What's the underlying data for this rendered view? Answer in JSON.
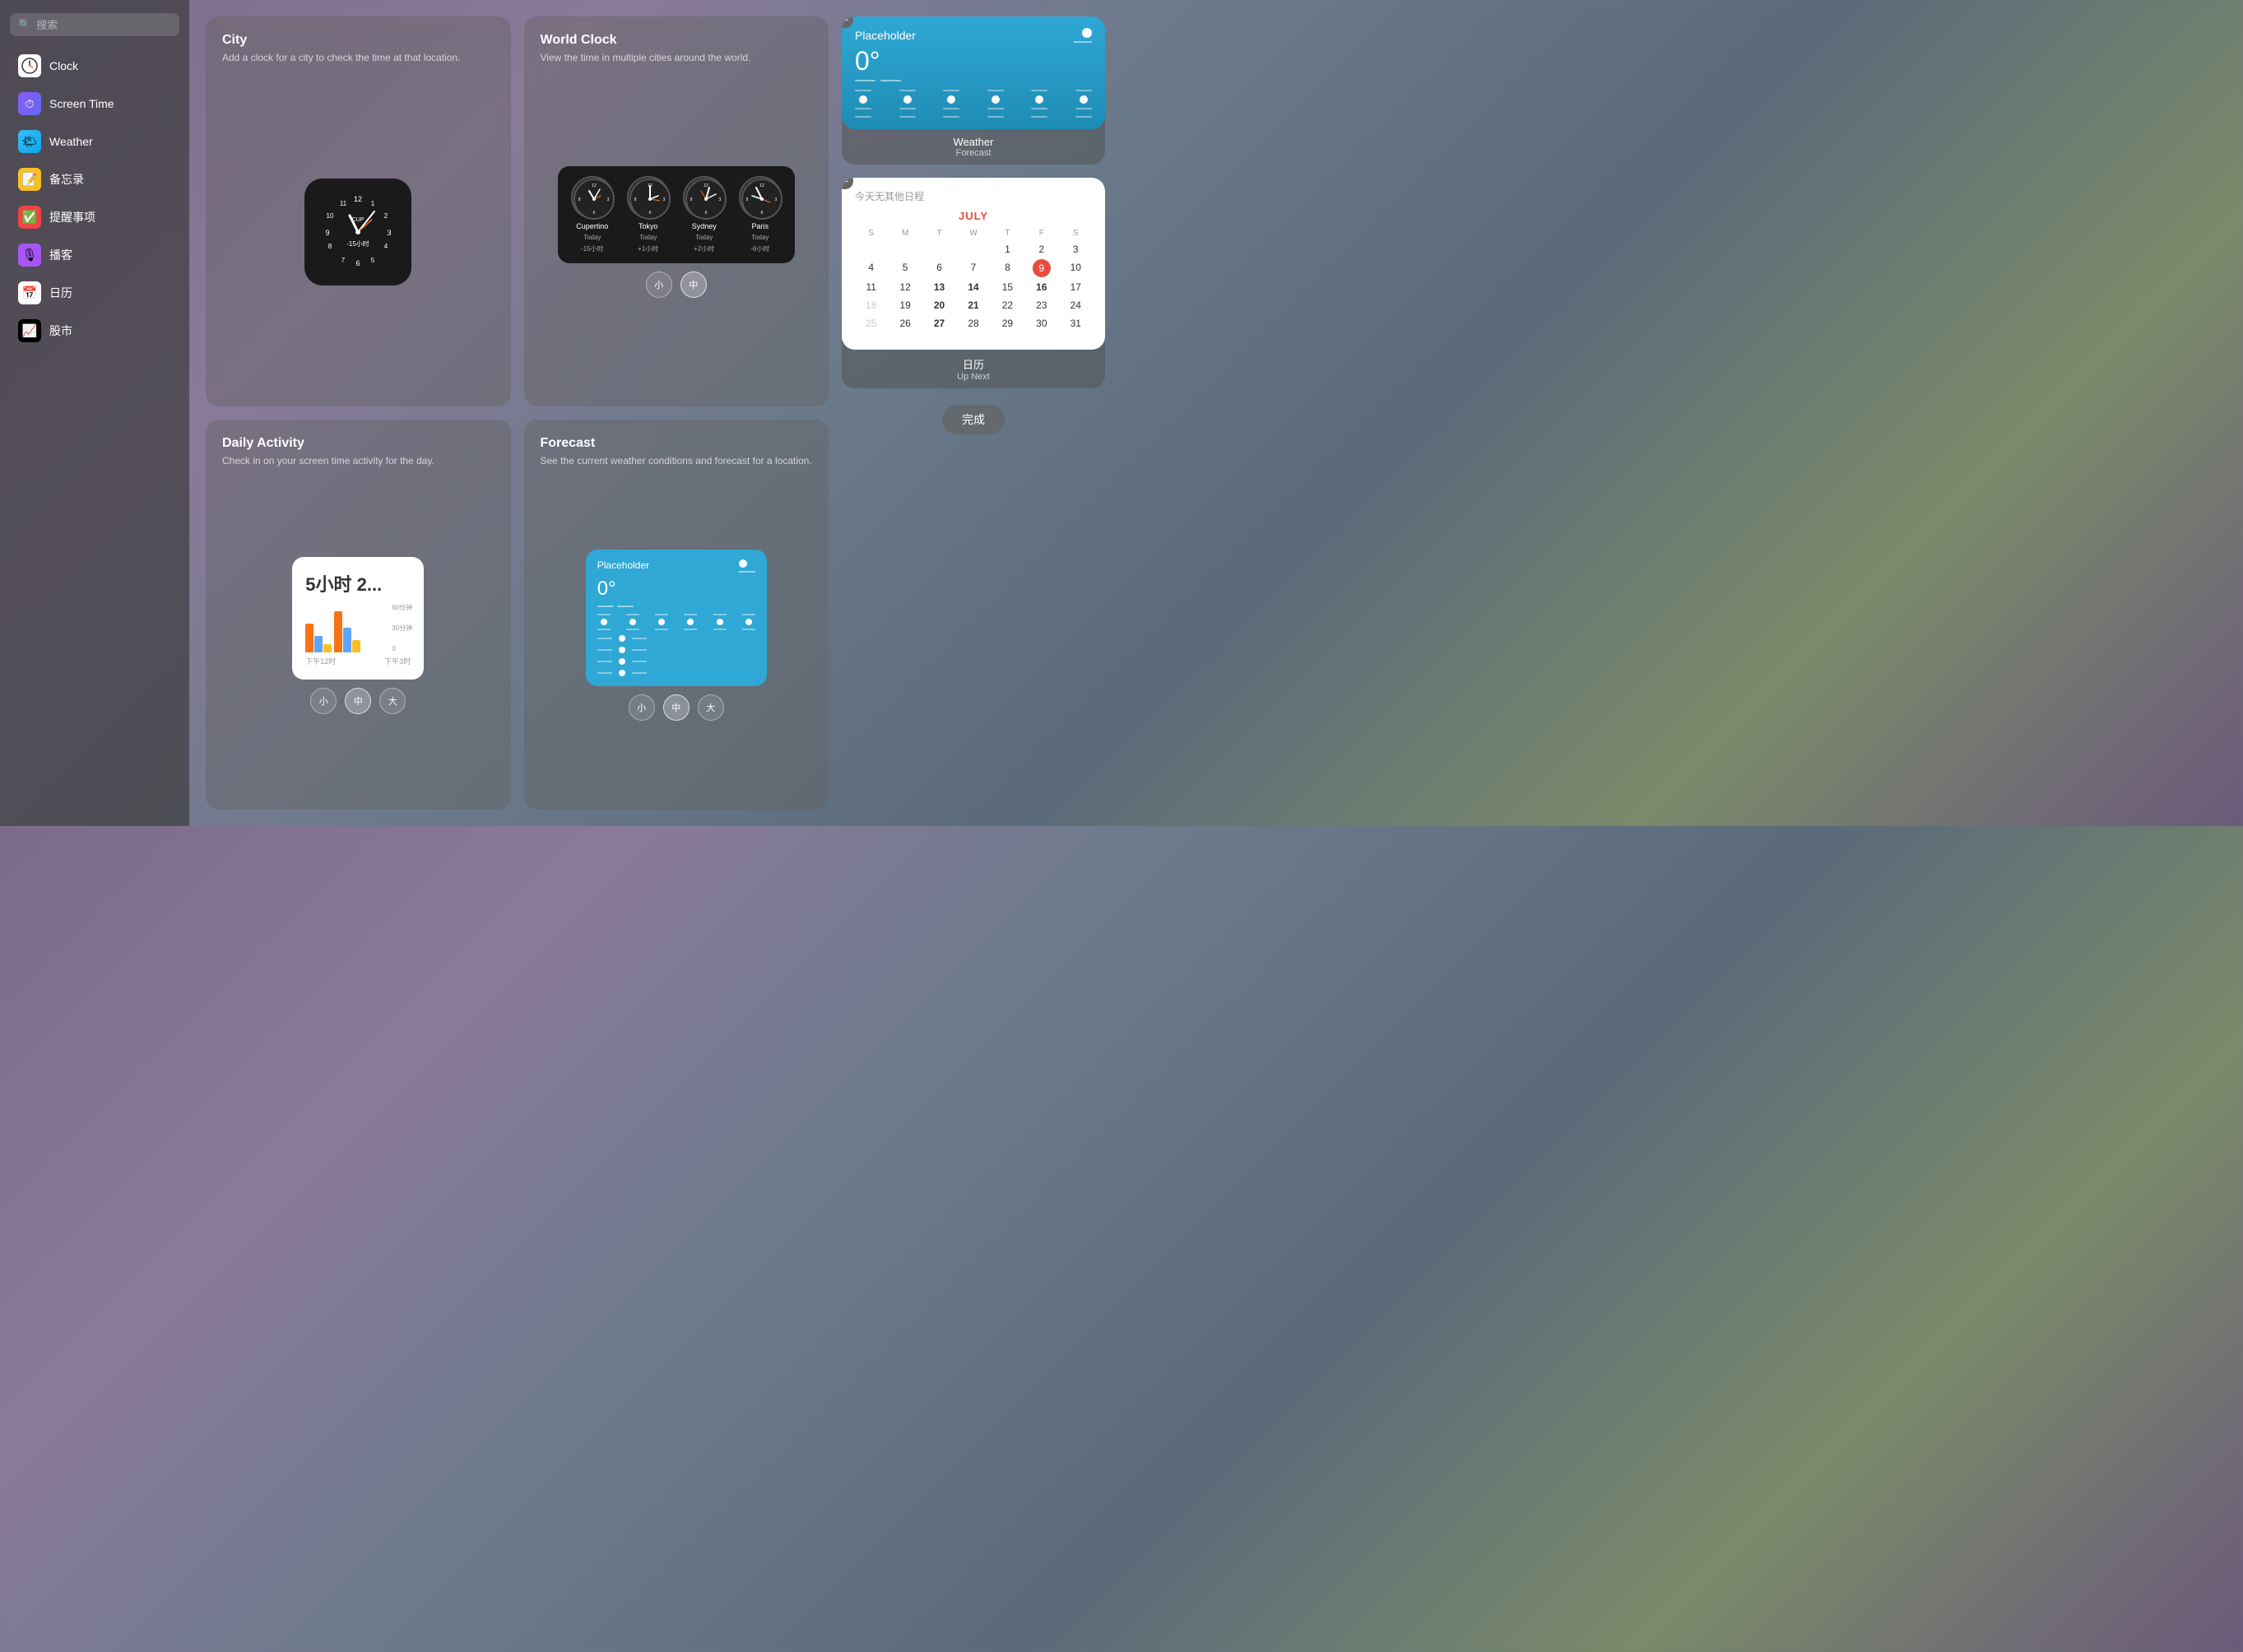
{
  "sidebar": {
    "search_placeholder": "搜索",
    "items": [
      {
        "id": "clock",
        "label": "Clock",
        "icon": "🕐",
        "icon_type": "clock"
      },
      {
        "id": "screentime",
        "label": "Screen Time",
        "icon": "⏱",
        "icon_type": "screentime"
      },
      {
        "id": "weather",
        "label": "Weather",
        "icon": "🌤",
        "icon_type": "weather"
      },
      {
        "id": "notes",
        "label": "备忘录",
        "icon": "📝",
        "icon_type": "notes"
      },
      {
        "id": "reminders",
        "label": "提醒事项",
        "icon": "✅",
        "icon_type": "reminders"
      },
      {
        "id": "podcasts",
        "label": "播客",
        "icon": "🎙",
        "icon_type": "podcasts"
      },
      {
        "id": "calendar",
        "label": "日历",
        "icon": "📅",
        "icon_type": "calendar"
      },
      {
        "id": "stocks",
        "label": "股市",
        "icon": "📈",
        "icon_type": "stocks"
      }
    ]
  },
  "panels": {
    "city": {
      "title": "City",
      "description": "Add a clock for a city to check the time at that location."
    },
    "world_clock": {
      "title": "World Clock",
      "description": "View the time in multiple cities around the world.",
      "cities": [
        {
          "name": "Cupertino",
          "day": "Today",
          "offset": "-15小时"
        },
        {
          "name": "Tokyo",
          "day": "Today",
          "offset": "+1小时"
        },
        {
          "name": "Sydney",
          "day": "Today",
          "offset": "+2小时"
        },
        {
          "name": "Paris",
          "day": "Today",
          "offset": "-6小时"
        }
      ],
      "sizes": [
        "小",
        "中"
      ]
    },
    "daily_activity": {
      "title": "Daily Activity",
      "description": "Check in on your screen time activity for the day.",
      "time_display": "5小时 2...",
      "sizes": [
        "小",
        "中",
        "大"
      ]
    },
    "forecast": {
      "title": "Forecast",
      "description": "See the current weather conditions and forecast for a location.",
      "placeholder": "Placeholder",
      "temp": "0°",
      "sizes": [
        "小",
        "中",
        "大"
      ]
    }
  },
  "right_panel": {
    "weather_widget": {
      "placeholder": "Placeholder",
      "temp": "0°",
      "label_title": "Weather",
      "label_sub": "Forecast"
    },
    "calendar_widget": {
      "no_events": "今天无其他日程",
      "month": "JULY",
      "day_headers": [
        "S",
        "M",
        "T",
        "W",
        "T",
        "F",
        "S"
      ],
      "weeks": [
        [
          "",
          "",
          "",
          "",
          "1",
          "2",
          "3",
          "4"
        ],
        [
          "5",
          "6",
          "7",
          "8",
          "9",
          "10",
          "11"
        ],
        [
          "12",
          "13",
          "14",
          "15",
          "16",
          "17",
          "18"
        ],
        [
          "19",
          "20",
          "21",
          "22",
          "23",
          "24",
          "25"
        ],
        [
          "26",
          "27",
          "28",
          "29",
          "30",
          "31",
          ""
        ]
      ],
      "today": "9",
      "label_title": "日历",
      "label_sub": "Up Next"
    },
    "done_button": "完成"
  }
}
